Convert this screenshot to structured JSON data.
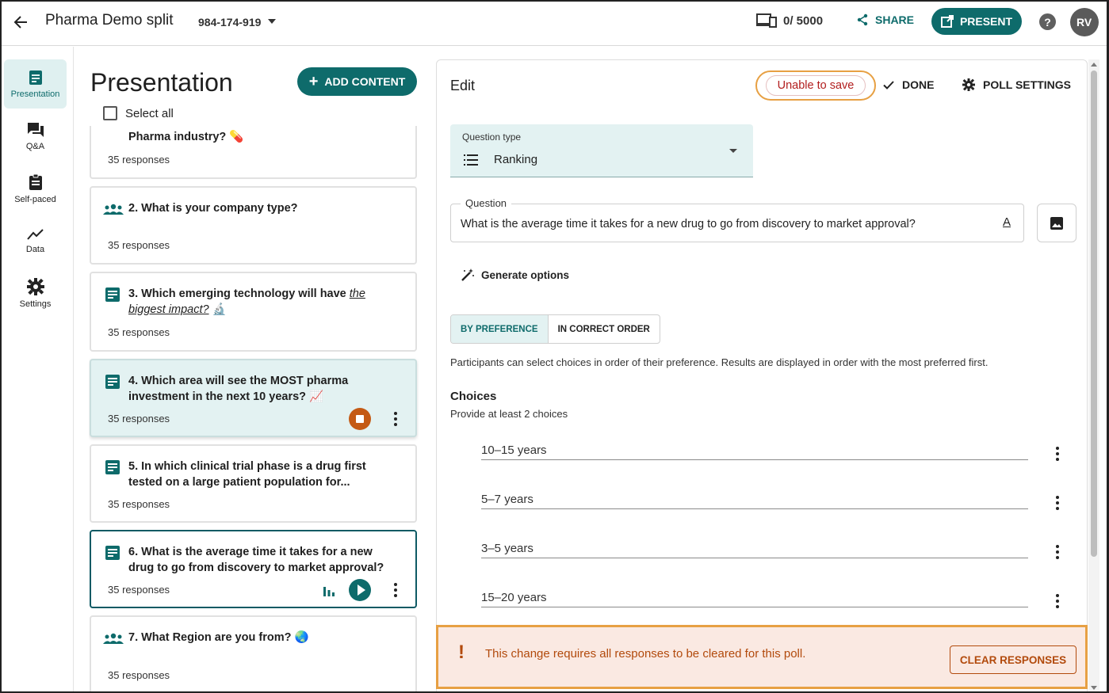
{
  "header": {
    "title": "Pharma Demo split",
    "event_code": "984-174-919",
    "participants": "0/ 5000",
    "share_label": "SHARE",
    "present_label": "PRESENT",
    "help_label": "?",
    "avatar_initials": "RV"
  },
  "rail": {
    "items": [
      {
        "label": "Presentation",
        "icon": "presentation-icon"
      },
      {
        "label": "Q&A",
        "icon": "chat-icon"
      },
      {
        "label": "Self-paced",
        "icon": "clipboard-icon"
      },
      {
        "label": "Data",
        "icon": "trend-icon"
      },
      {
        "label": "Settings",
        "icon": "gear-icon"
      }
    ]
  },
  "presentation": {
    "title": "Presentation",
    "add_content_label": "ADD CONTENT",
    "select_all_label": "Select all",
    "cards": [
      {
        "title": "Pharma industry? 💊",
        "responses": "35 responses"
      },
      {
        "number": "2.",
        "title": "What is your company type?",
        "responses": "35 responses"
      },
      {
        "number": "3.",
        "title_a": "Which emerging technology will have ",
        "title_b": "the biggest impact?",
        "title_c": " 🔬",
        "responses": "35 responses"
      },
      {
        "number": "4.",
        "title_a": "Which area will see the ",
        "title_b": "MOST",
        "title_c": " pharma investment in the next 10 years? 📈",
        "responses": "35 responses"
      },
      {
        "number": "5.",
        "title": "In which clinical trial phase is a drug first tested on a large patient population for...",
        "responses": "35 responses"
      },
      {
        "number": "6.",
        "title": "What is the average time it takes for a new drug to go from discovery to market approval?",
        "responses": "35 responses"
      },
      {
        "number": "7.",
        "title": "What Region are you from? 🌏",
        "responses": "35 responses"
      }
    ]
  },
  "edit": {
    "title": "Edit",
    "status": "Unable to save",
    "done_label": "DONE",
    "poll_settings_label": "POLL SETTINGS",
    "question_type_label": "Question type",
    "question_type_value": "Ranking",
    "question_label": "Question",
    "question_text": "What is the average time it takes for a new drug to go from discovery to market approval?",
    "format_glyph": "A",
    "generate_label": "Generate options",
    "toggle": {
      "left": "BY PREFERENCE",
      "right": "IN CORRECT ORDER",
      "selected": "BY PREFERENCE"
    },
    "helper_text": "Participants can select choices in order of their preference. Results are displayed in order with the most preferred first.",
    "choices_heading": "Choices",
    "choices_sub": "Provide at least 2 choices",
    "choices": [
      "10–15 years",
      "5–7 years",
      "3–5 years",
      "15–20 years"
    ]
  },
  "warning": {
    "mark": "!",
    "text": "This change requires all responses to be cleared for this poll.",
    "button_label": "CLEAR RESPONSES"
  },
  "colors": {
    "accent": "#0e6b6b",
    "warning": "#b24a0c",
    "error": "#b21e1e",
    "highlight": "#e7a043"
  }
}
